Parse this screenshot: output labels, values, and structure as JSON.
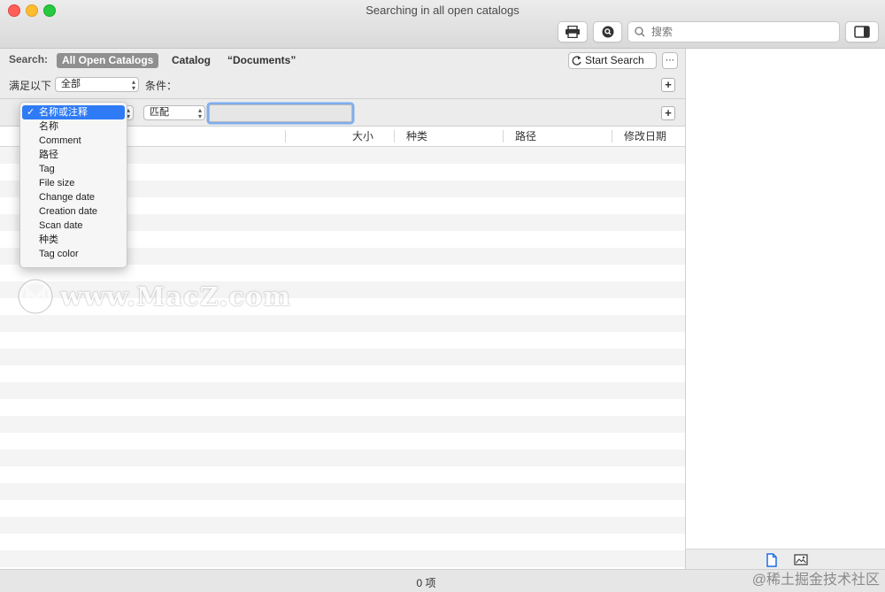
{
  "window": {
    "title": "Searching in all open catalogs"
  },
  "toolbar": {
    "search_placeholder": "搜索"
  },
  "scope": {
    "label": "Search:",
    "items": [
      {
        "label": "All Open Catalogs",
        "selected": true
      },
      {
        "label": "Catalog",
        "selected": false
      },
      {
        "label": "“Documents”",
        "selected": false
      }
    ],
    "start_search": "Start Search",
    "more": "⋯"
  },
  "condition": {
    "label": "满足以下",
    "value": "全部",
    "suffix": "条件："
  },
  "criterion": {
    "operator": "匹配"
  },
  "columns": [
    "大小",
    "种类",
    "路径",
    "修改日期"
  ],
  "field_menu": {
    "selected": "名称或注释",
    "items": [
      "名称或注释",
      "名称",
      "Comment",
      "路径",
      "Tag",
      "File size",
      "Change date",
      "Creation date",
      "Scan date",
      "种类",
      "Tag color"
    ]
  },
  "status": {
    "text": "0 项"
  },
  "watermark": {
    "text": "www.MacZ.com"
  },
  "credit": {
    "text": "@稀土掘金技术社区"
  },
  "colors": {
    "selection": "#2f7bf5",
    "close": "#fe5f57",
    "minimize": "#febc2e",
    "zoom": "#28c840"
  }
}
